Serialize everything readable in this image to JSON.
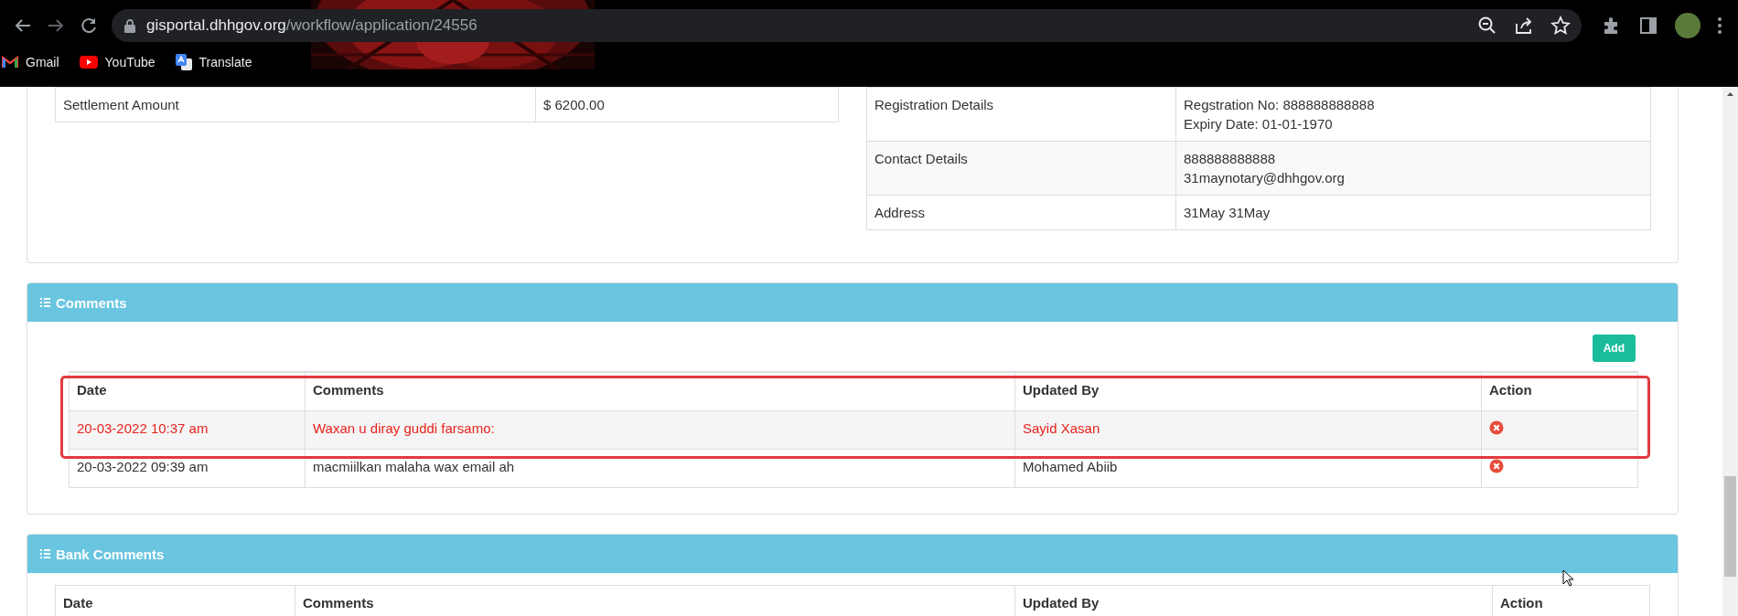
{
  "browser": {
    "url_host": "gisportal.dhhgov.org",
    "url_path": "/workflow/application/24556",
    "bookmarks": [
      {
        "label": "Gmail",
        "kind": "gmail"
      },
      {
        "label": "YouTube",
        "kind": "youtube"
      },
      {
        "label": "Translate",
        "kind": "translate"
      }
    ]
  },
  "summary_table": {
    "rows": [
      {
        "label": "Settlement Amount",
        "lines": [
          "$ 6200.00"
        ]
      }
    ]
  },
  "details_table": {
    "rows": [
      {
        "label": "Registration Details",
        "lines": [
          "Regstration No: 888888888888",
          "Expiry Date: 01-01-1970"
        ]
      },
      {
        "label": "Contact Details",
        "lines": [
          "888888888888",
          "31maynotary@dhhgov.org"
        ]
      },
      {
        "label": "Address",
        "lines": [
          "31May 31May"
        ]
      }
    ]
  },
  "comments": {
    "title": "Comments",
    "add_button": "Add",
    "columns": [
      "Date",
      "Comments",
      "Updated By",
      "Action"
    ],
    "rows": [
      {
        "date": "20-03-2022 10:37 am",
        "comment": "Waxan u diray guddi farsamo:",
        "updated_by": "Sayid Xasan",
        "highlighted": true
      },
      {
        "date": "20-03-2022 09:39 am",
        "comment": "macmiilkan malaha wax email ah",
        "updated_by": "Mohamed Abiib",
        "highlighted": false
      }
    ]
  },
  "bank_comments": {
    "title": "Bank Comments",
    "columns": [
      "Date",
      "Comments",
      "Updated By",
      "Action"
    ]
  }
}
